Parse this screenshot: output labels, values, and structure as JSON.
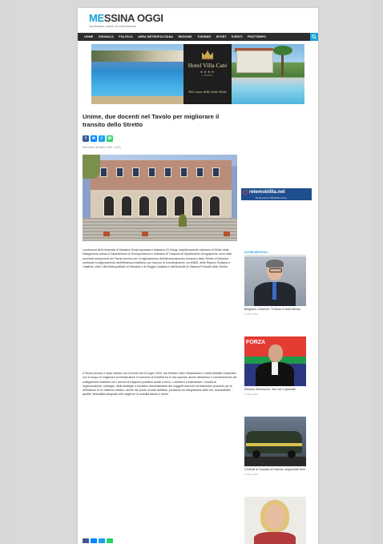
{
  "site": {
    "logo_part1": "ME",
    "logo_part2": "SSINA OGGI",
    "tagline": "Quotidiano online di informazione"
  },
  "nav": {
    "items": [
      "Home",
      "Cronaca",
      "Politica",
      "Area Metropolitana",
      "Regione",
      "Turismo",
      "Sport",
      "Eventi",
      "Frattempo"
    ],
    "search_icon": "search-icon"
  },
  "banner": {
    "hotel_name": "Hotel Villa Cate",
    "stars": "★★★★",
    "city": "LIPARI",
    "tagline": "Nel cuore delle Isole Eolie"
  },
  "article": {
    "title": "Unime, due docenti nel Tavolo per migliorare il transito dello Stretto",
    "share_buttons": [
      "facebook",
      "messenger",
      "twitter",
      "whatsapp"
    ],
    "date": "Mercoledì, 06 Marzo 2024 - 10:21",
    "paragraph1": "I professori dell'Università di Messina Sonia Ingrassia e Massimo Di Gangi, rispettivamente ordinario di Diritto della Navigazione presso il Dipartimento di Giurisprudenza e ordinario di Trasporti al Dipartimento di Ingegneria, sono stati nominati componenti del Tavolo tecnico per il miglioramento dell'attraversamento dinamico dello Stretto di Messina mediante il miglioramento dell'efficienza marittima con l'azione di coordinamento, tra MIMS, delle Regioni Siciliana e Calabria, delle Città Metropolitane di Messina e di Reggio Calabria e dell'Autorità di Sistema Portuale dello Stretto.",
    "paragraph2": "Il Tavolo tecnico è stato istituito con Decreto del 20 luglio 2023, dal Ministro delle Infrastrutture e della Mobilità Sostenibili con lo scopo di migliorare la infrastrutture e il servizio di mobilità tra le due sponde, anche attraverso il coordinamento dei collegamenti marittimi con i servizi di trasporto pubblico locale a terra. L'obiettivo è individuare i modelli di organizzazione, strategie, delle strategie e iniziative amministrative dei soggetti coinvolti nel elaborare proposte per la definizione di un sistema unitario, anche dal punto di vista tariffario, puntando ad integrazione delle reti, accessibilità, qualità, flessibilità adeguate alle esigenze di mobilità attuali e future."
  },
  "side_ad": {
    "brand": "retemobilita.net",
    "powered": "Media partner MESSINA OGGI"
  },
  "sidebar": {
    "heading": "ULTIMI ARTICOLI",
    "items": [
      {
        "caption": "Bisignani, Calderoli: \"Il futuro è nella riforma",
        "date": "6 marzo 2024"
      },
      {
        "caption": "Elezioni, Berlusconi: \"Noi non è giornale\"",
        "date": "6 marzo 2024"
      },
      {
        "caption": "Controlli di Guardia di Finanza, sequestrati beni",
        "date": "6 marzo 2024"
      },
      {
        "caption": "",
        "date": ""
      }
    ]
  },
  "colors": {
    "accent": "#1aa3d8",
    "nav_bg": "#2d2d2d",
    "title_text": "#222222",
    "facebook": "#3b5998",
    "messenger": "#0084ff",
    "twitter": "#1da1f2",
    "whatsapp": "#25d366"
  }
}
